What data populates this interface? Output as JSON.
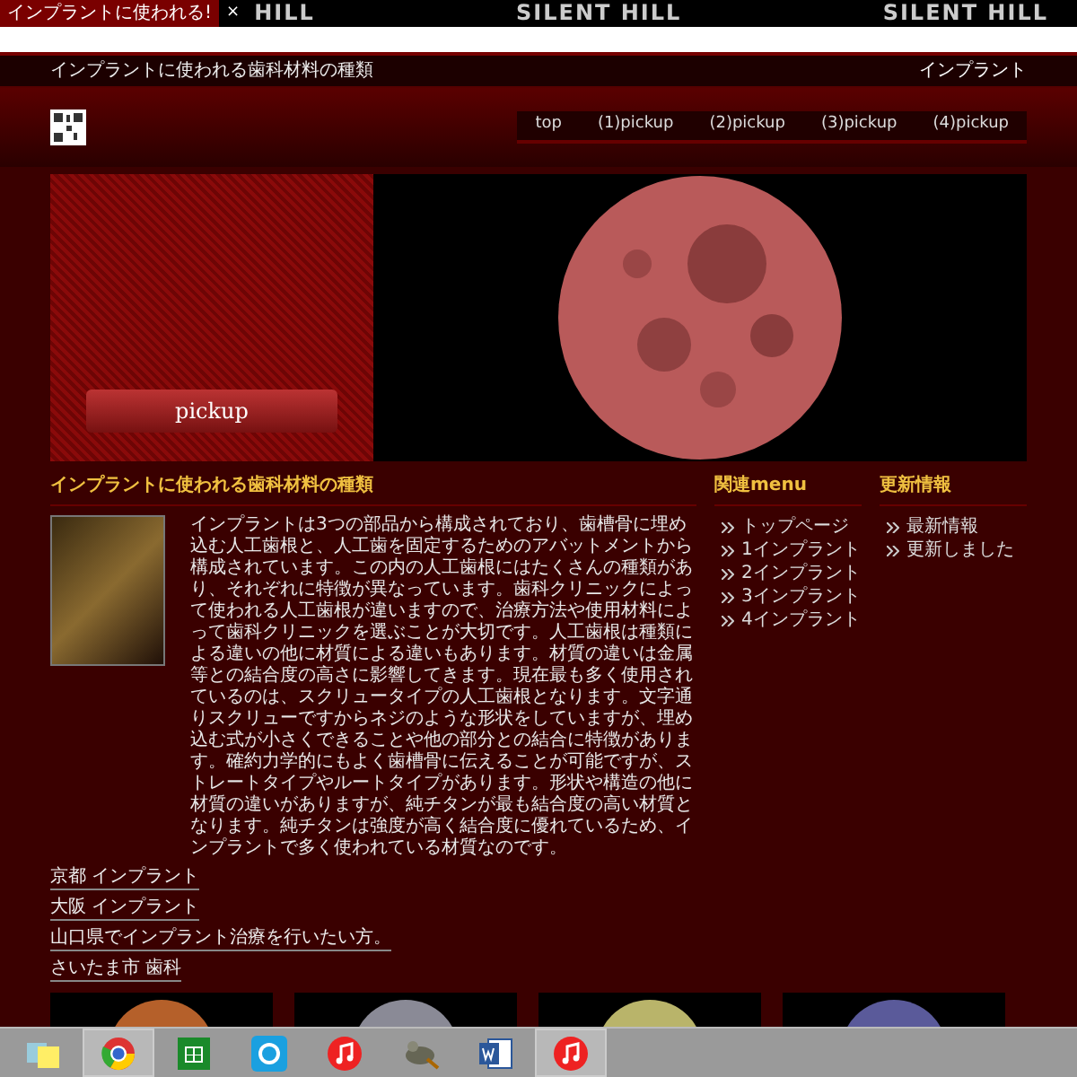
{
  "browser": {
    "tab_title": "インプラントに使われる!",
    "tab_close": "×",
    "theme_texts": [
      "HILL",
      "SILENT HILL",
      "SILENT HILL"
    ]
  },
  "header": {
    "title": "インプラントに使われる歯科材料の種類",
    "link": "インプラント"
  },
  "nav": [
    "top",
    "(1)pickup",
    "(2)pickup",
    "(3)pickup",
    "(4)pickup"
  ],
  "hero": {
    "button": "pickup"
  },
  "article": {
    "heading": "インプラントに使われる歯科材料の種類",
    "paragraph": "インプラントは3つの部品から構成されており、歯槽骨に埋め込む人工歯根と、人工歯を固定するためのアバットメントから構成されています。この内の人工歯根にはたくさんの種類があり、それぞれに特徴が異なっています。歯科クリニックによって使われる人工歯根が違いますので、治療方法や使用材料によって歯科クリニックを選ぶことが大切です。人工歯根は種類による違いの他に材質による違いもあります。材質の違いは金属等との結合度の高さに影響してきます。現在最も多く使用されているのは、スクリュータイプの人工歯根となります。文字通りスクリューですからネジのような形状をしていますが、埋め込む式が小さくできることや他の部分との結合に特徴があります。確約力学的にもよく歯槽骨に伝えることが可能ですが、ストレートタイプやルートタイプがあります。形状や構造の他に材質の違いがありますが、純チタンが最も結合度の高い材質となります。純チタンは強度が高く結合度に優れているため、インプラントで多く使われている材質なのです。",
    "links": [
      "京都 インプラント",
      "大阪 インプラント",
      "山口県でインプラント治療を行いたい方。",
      "さいたま市 歯科"
    ]
  },
  "menu": {
    "heading": "関連menu",
    "items": [
      "トップページ",
      "1インプラント",
      "2インプラント",
      "3インプラント",
      "4インプラント"
    ]
  },
  "news": {
    "heading": "更新情報",
    "items": [
      "最新情報",
      "更新しました"
    ]
  },
  "thumbnails": [
    {
      "color": "#b5602a"
    },
    {
      "color": "#8a8a96"
    },
    {
      "color": "#b9b46a"
    },
    {
      "color": "#5a5a9a"
    }
  ]
}
